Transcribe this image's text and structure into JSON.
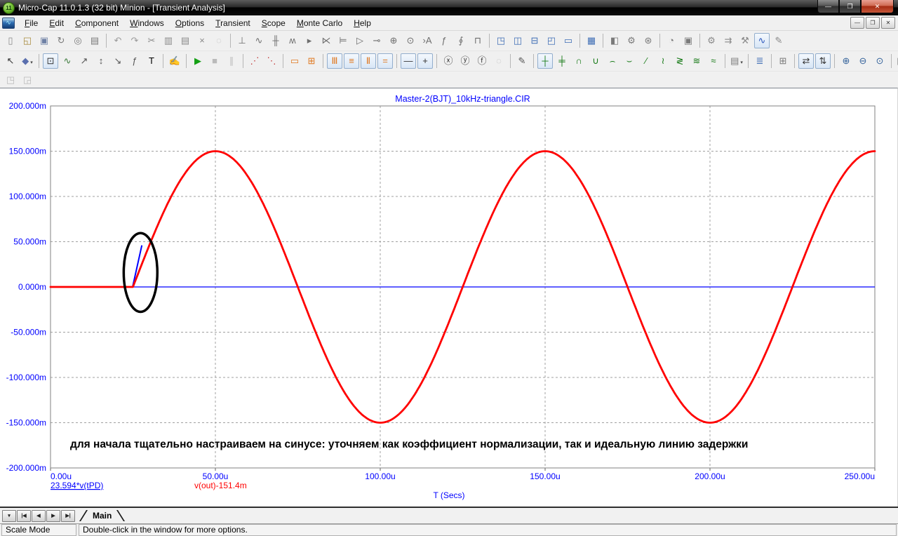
{
  "window": {
    "title": "Micro-Cap 11.0.1.3 (32 bit) Minion - [Transient Analysis]",
    "app_badge": "11",
    "controls": [
      {
        "name": "minimize",
        "glyph": "—"
      },
      {
        "name": "restore",
        "glyph": "❐"
      },
      {
        "name": "close",
        "glyph": "✕"
      }
    ]
  },
  "menubar": {
    "items": [
      {
        "label": "File"
      },
      {
        "label": "Edit"
      },
      {
        "label": "Component"
      },
      {
        "label": "Windows"
      },
      {
        "label": "Options"
      },
      {
        "label": "Transient"
      },
      {
        "label": "Scope"
      },
      {
        "label": "Monte Carlo"
      },
      {
        "label": "Help"
      }
    ],
    "mdi_controls": [
      {
        "name": "mdi-minimize",
        "glyph": "—"
      },
      {
        "name": "mdi-restore",
        "glyph": "❐"
      },
      {
        "name": "mdi-close",
        "glyph": "✕"
      }
    ]
  },
  "toolbars": {
    "row1": [
      {
        "icons": [
          {
            "name": "new-circuit",
            "glyph": "▯",
            "color": "#8a8a8a"
          },
          {
            "name": "open-circuit",
            "glyph": "◱",
            "color": "#a98c3f"
          },
          {
            "name": "save-circuit",
            "glyph": "▣",
            "color": "#6f81a5"
          },
          {
            "name": "revert-circuit",
            "glyph": "↻",
            "color": "#7a7a7a"
          },
          {
            "name": "print-preview",
            "glyph": "◎",
            "color": "#7a7a7a"
          },
          {
            "name": "print",
            "glyph": "▤",
            "color": "#7a7a7a"
          }
        ]
      },
      {
        "icons": [
          {
            "name": "undo",
            "glyph": "↶",
            "color": "#9a9a9a"
          },
          {
            "name": "redo",
            "glyph": "↷",
            "color": "#9a9a9a"
          },
          {
            "name": "cut",
            "glyph": "✂",
            "color": "#8a8a8a"
          },
          {
            "name": "copy",
            "glyph": "▥",
            "color": "#8a8a8a"
          },
          {
            "name": "paste",
            "glyph": "▤",
            "color": "#8a8a8a"
          },
          {
            "name": "delete",
            "glyph": "×",
            "color": "#8a8a8a"
          },
          {
            "name": "select-special",
            "glyph": "◌",
            "disabled": true
          }
        ]
      },
      {
        "icons": [
          {
            "name": "ground-component",
            "glyph": "⊥",
            "color": "#6e6e6e"
          },
          {
            "name": "resistor-component",
            "glyph": "∿",
            "color": "#6e6e6e"
          },
          {
            "name": "capacitor-component",
            "glyph": "╫",
            "color": "#6e6e6e"
          },
          {
            "name": "inductor-component",
            "glyph": "ʍ",
            "color": "#6e6e6e"
          },
          {
            "name": "diode-component",
            "glyph": "▸",
            "color": "#6e6e6e"
          },
          {
            "name": "bjt-component",
            "glyph": "⋉",
            "color": "#6e6e6e"
          },
          {
            "name": "mosfet-component",
            "glyph": "⊨",
            "color": "#6e6e6e"
          },
          {
            "name": "opamp-component",
            "glyph": "▷",
            "color": "#6e6e6e"
          },
          {
            "name": "terminal-component",
            "glyph": "⊸",
            "color": "#6e6e6e"
          },
          {
            "name": "battery-component",
            "glyph": "⊕",
            "color": "#6e6e6e"
          },
          {
            "name": "source-component",
            "glyph": "⊙",
            "color": "#6e6e6e"
          },
          {
            "name": "pin-text-component",
            "glyph": "›A",
            "color": "#6e6e6e"
          },
          {
            "name": "formula-component",
            "glyph": "ƒ",
            "color": "#6e6e6e"
          },
          {
            "name": "sine-source-component",
            "glyph": "∮",
            "color": "#6e6e6e"
          },
          {
            "name": "pulse-source-component",
            "glyph": "⊓",
            "color": "#6e6e6e"
          }
        ]
      },
      {
        "icons": [
          {
            "name": "cascade-windows",
            "glyph": "◳",
            "color": "#3e6db5"
          },
          {
            "name": "tile-vertical",
            "glyph": "◫",
            "color": "#3e6db5"
          },
          {
            "name": "tile-horizontal",
            "glyph": "⊟",
            "color": "#3e6db5"
          },
          {
            "name": "overlap-windows",
            "glyph": "◰",
            "color": "#3e6db5"
          },
          {
            "name": "maximize-window",
            "glyph": "▭",
            "color": "#3e6db5"
          }
        ]
      },
      {
        "icons": [
          {
            "name": "calculator",
            "glyph": "▦",
            "color": "#3e6db5"
          }
        ]
      },
      {
        "icons": [
          {
            "name": "component-panel",
            "glyph": "◧",
            "color": "#7a7a7a"
          },
          {
            "name": "component-editor",
            "glyph": "⚙",
            "color": "#7a7a7a"
          },
          {
            "name": "web-update",
            "glyph": "⊛",
            "color": "#7a7a7a"
          }
        ]
      },
      {
        "icons": [
          {
            "name": "animate-mode",
            "glyph": "◔",
            "color": "#7a7a7a"
          },
          {
            "name": "active-window",
            "glyph": "▣",
            "color": "#7a7a7a"
          }
        ]
      },
      {
        "icons": [
          {
            "name": "preferences",
            "glyph": "⚙",
            "color": "#8a8a8a"
          },
          {
            "name": "stepping",
            "glyph": "⇉",
            "color": "#8a8a8a"
          },
          {
            "name": "analysis-tools",
            "glyph": "⚒",
            "color": "#8a8a8a"
          },
          {
            "name": "analysis-plot",
            "glyph": "∿",
            "color": "#2a55bb",
            "pressed": true
          },
          {
            "name": "analysis-edit",
            "glyph": "✎",
            "color": "#8a8a8a"
          }
        ]
      }
    ],
    "row2": [
      {
        "icons": [
          {
            "name": "select-mode",
            "glyph": "↖",
            "color": "#333333"
          },
          {
            "name": "graphics-mode",
            "glyph": "◆",
            "color": "#5a6fae",
            "dropdown": true
          }
        ]
      },
      {
        "icons": [
          {
            "name": "zoom-mode",
            "glyph": "⊡",
            "color": "#333333",
            "pressed": true
          },
          {
            "name": "scale-mode",
            "glyph": "∿",
            "color": "#3a7a3a"
          },
          {
            "name": "pan-mode",
            "glyph": "↗",
            "color": "#555555"
          },
          {
            "name": "vertical-scale-mode",
            "glyph": "↕",
            "color": "#555555"
          },
          {
            "name": "corner-scale-mode",
            "glyph": "↘",
            "color": "#555555"
          },
          {
            "name": "formula-scale-mode",
            "glyph": "ƒ",
            "color": "#555555"
          },
          {
            "name": "text-mode",
            "glyph": "T",
            "color": "#000000"
          }
        ]
      },
      {
        "icons": [
          {
            "name": "properties",
            "glyph": "✍",
            "color": "#9a8a4a"
          }
        ]
      },
      {
        "icons": [
          {
            "name": "run-simulation",
            "glyph": "▶",
            "color": "#15a015"
          },
          {
            "name": "stop-simulation",
            "glyph": "■",
            "disabled": true
          },
          {
            "name": "pause-simulation",
            "glyph": "∥",
            "disabled": true
          }
        ]
      },
      {
        "icons": [
          {
            "name": "data-points",
            "glyph": "⋰",
            "color": "#c23a3a"
          },
          {
            "name": "tolerances",
            "glyph": "⋱",
            "color": "#c23a3a"
          }
        ]
      },
      {
        "icons": [
          {
            "name": "select-region",
            "glyph": "▭",
            "color": "#e07820"
          },
          {
            "name": "point-tags",
            "glyph": "⊞",
            "color": "#e07820"
          }
        ]
      },
      {
        "icons": [
          {
            "name": "vertical-grid",
            "glyph": "Ⅲ",
            "color": "#e07820",
            "pressed": true
          },
          {
            "name": "horizontal-grid",
            "glyph": "≡",
            "color": "#e07820",
            "pressed": true
          },
          {
            "name": "minor-vertical-grid",
            "glyph": "Ⅱ",
            "color": "#e07820",
            "pressed": true
          },
          {
            "name": "minor-horizontal-grid",
            "glyph": "=",
            "color": "#e07820",
            "pressed": true
          }
        ]
      },
      {
        "icons": [
          {
            "name": "baseline-mode",
            "glyph": "—",
            "color": "#333333",
            "pressed": true
          },
          {
            "name": "cursor-crosshair-mode",
            "glyph": "+",
            "color": "#333333",
            "pressed": true
          }
        ]
      },
      {
        "icons": [
          {
            "name": "x-axis-zoom",
            "glyph": "ⓧ",
            "color": "#333333"
          },
          {
            "name": "y-axis-zoom",
            "glyph": "ⓨ",
            "color": "#333333"
          },
          {
            "name": "fx-axis-zoom",
            "glyph": "ⓕ",
            "color": "#333333"
          },
          {
            "name": "axis-zoom-off",
            "glyph": "◌",
            "disabled": true
          }
        ]
      },
      {
        "icons": [
          {
            "name": "edit-data",
            "glyph": "✎",
            "color": "#555555"
          }
        ]
      },
      {
        "icons": [
          {
            "name": "cursor-select",
            "glyph": "┼",
            "color": "#177a17",
            "pressed": true
          },
          {
            "name": "cursor-track",
            "glyph": "╪",
            "color": "#177a17"
          },
          {
            "name": "go-to-peak",
            "glyph": "∩",
            "color": "#177a17"
          },
          {
            "name": "go-to-valley",
            "glyph": "∪",
            "color": "#177a17"
          },
          {
            "name": "go-to-high",
            "glyph": "⌢",
            "color": "#177a17"
          },
          {
            "name": "go-to-low",
            "glyph": "⌣",
            "color": "#177a17"
          },
          {
            "name": "go-to-slope",
            "glyph": "∕",
            "color": "#177a17"
          },
          {
            "name": "go-to-inflection",
            "glyph": "≀",
            "color": "#177a17"
          },
          {
            "name": "go-to-global-extreme",
            "glyph": "≷",
            "color": "#177a17"
          },
          {
            "name": "envelope-upper",
            "glyph": "≋",
            "color": "#177a17"
          },
          {
            "name": "envelope-lower",
            "glyph": "≈",
            "color": "#177a17"
          }
        ]
      },
      {
        "icons": [
          {
            "name": "paste-waveform",
            "glyph": "▤",
            "color": "#7a7a7a",
            "dropdown": true
          }
        ]
      },
      {
        "icons": [
          {
            "name": "numeric-output",
            "glyph": "≣",
            "color": "#3e6db5"
          }
        ]
      },
      {
        "icons": [
          {
            "name": "clipboard-numeric",
            "glyph": "⊞",
            "color": "#7a7a7a"
          }
        ]
      },
      {
        "icons": [
          {
            "name": "auto-scale-horizontal",
            "glyph": "⇄",
            "color": "#333333",
            "pressed": true
          },
          {
            "name": "auto-scale-vertical",
            "glyph": "⇅",
            "color": "#333333",
            "pressed": true
          }
        ]
      },
      {
        "icons": [
          {
            "name": "zoom-in",
            "glyph": "⊕",
            "color": "#35639b"
          },
          {
            "name": "zoom-out",
            "glyph": "⊖",
            "color": "#35639b"
          },
          {
            "name": "zoom-100",
            "glyph": "⊙",
            "color": "#35639b"
          }
        ]
      },
      {
        "icons": [
          {
            "name": "panel-layout",
            "glyph": "▦",
            "color": "#8a8a8a",
            "dropdown": true
          }
        ]
      },
      {
        "icons": [
          {
            "name": "font-settings",
            "glyph": "A",
            "color": "#1a3fbf"
          }
        ]
      }
    ],
    "row3": [
      {
        "icons": [
          {
            "name": "bring-to-front",
            "glyph": "◳",
            "disabled": true
          },
          {
            "name": "send-to-back",
            "glyph": "◲",
            "disabled": true
          }
        ]
      }
    ]
  },
  "chart_data": {
    "type": "line",
    "title": "Master-2(BJT)_10kHz-triangle.CIR",
    "xlabel": "T (Secs)",
    "ylabel": "",
    "xlim_us": [
      0,
      250
    ],
    "ylim_m": [
      -200,
      200
    ],
    "grid": "dashed",
    "x_ticks": [
      {
        "value_us": 0,
        "label": "0.00u"
      },
      {
        "value_us": 50,
        "label": "50.00u"
      },
      {
        "value_us": 100,
        "label": "100.00u"
      },
      {
        "value_us": 150,
        "label": "150.00u"
      },
      {
        "value_us": 200,
        "label": "200.00u"
      },
      {
        "value_us": 250,
        "label": "250.00u"
      }
    ],
    "y_ticks": [
      {
        "value_m": 200,
        "label": "200.000m"
      },
      {
        "value_m": 150,
        "label": "150.000m"
      },
      {
        "value_m": 100,
        "label": "100.000m"
      },
      {
        "value_m": 50,
        "label": "50.000m"
      },
      {
        "value_m": 0,
        "label": "0.000m"
      },
      {
        "value_m": -50,
        "label": "-50.000m"
      },
      {
        "value_m": -100,
        "label": "-100.000m"
      },
      {
        "value_m": -150,
        "label": "-150.000m"
      },
      {
        "value_m": -200,
        "label": "-200.000m"
      }
    ],
    "series": [
      {
        "name": "23.594*v(tPD)",
        "color": "#0000ff",
        "legend_underline": true,
        "polylines_us_m": [
          [
            [
              0,
              0
            ],
            [
              250,
              0
            ]
          ],
          [
            [
              24.9,
              0
            ],
            [
              27.7,
              46
            ]
          ]
        ]
      },
      {
        "name": "v(out)-151.4m",
        "color": "#ff0000",
        "waveform": {
          "shape": "sine",
          "amplitude_m": 150,
          "period_us": 100,
          "start_us": 25,
          "flat_value_before_start_m": 0
        }
      }
    ],
    "annotations": {
      "note_text": "для начала тщательно настраиваем на синусе: уточняем как коэффициент нормализации, так и идеальную линию задержки",
      "ellipse": {
        "center_us": 27.3,
        "center_m": 16,
        "rx_us": 5.1,
        "ry_m": 43.5
      }
    }
  },
  "tabbar": {
    "nav_buttons": [
      {
        "name": "tab-list",
        "glyph": "▾"
      },
      {
        "name": "first-tab",
        "glyph": "|◀"
      },
      {
        "name": "prev-tab",
        "glyph": "◀"
      },
      {
        "name": "next-tab",
        "glyph": "▶"
      },
      {
        "name": "last-tab",
        "glyph": "▶|"
      }
    ],
    "tabs": [
      {
        "label": "Main",
        "active": true
      }
    ]
  },
  "statusbar": {
    "mode": "Scale Mode",
    "message": "Double-click in the window for more options."
  }
}
